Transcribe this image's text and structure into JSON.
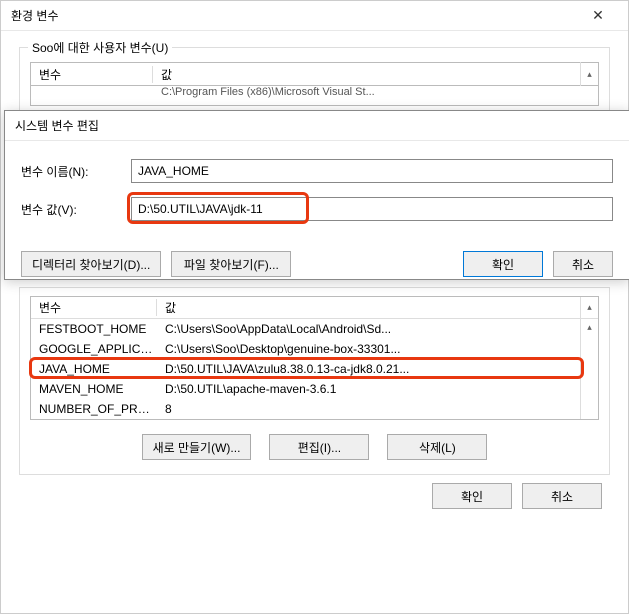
{
  "main_title": "환경 변수",
  "close_glyph": "✕",
  "user_vars": {
    "legend": "Soo에 대한 사용자 변수(U)",
    "col_var": "변수",
    "col_val": "값",
    "cut_row_value": "C:\\Program Files (x86)\\Microsoft Visual St..."
  },
  "edit_dialog": {
    "title": "시스템 변수 편집",
    "name_label": "변수 이름(N):",
    "name_value": "JAVA_HOME",
    "value_label": "변수 값(V):",
    "value_value": "D:\\50.UTIL\\JAVA\\jdk-11",
    "btn_dir": "디렉터리 찾아보기(D)...",
    "btn_file": "파일 찾아보기(F)...",
    "btn_ok": "확인",
    "btn_cancel": "취소"
  },
  "sys_vars": {
    "col_var": "변수",
    "col_val": "값",
    "rows": [
      {
        "name": "FESTBOOT_HOME",
        "value": "C:\\Users\\Soo\\AppData\\Local\\Android\\Sd..."
      },
      {
        "name": "GOOGLE_APPLICA...",
        "value": "C:\\Users\\Soo\\Desktop\\genuine-box-33301..."
      },
      {
        "name": "JAVA_HOME",
        "value": "D:\\50.UTIL\\JAVA\\zulu8.38.0.13-ca-jdk8.0.21..."
      },
      {
        "name": "MAVEN_HOME",
        "value": "D:\\50.UTIL\\apache-maven-3.6.1"
      },
      {
        "name": "NUMBER_OF_PROC...",
        "value": "8"
      }
    ],
    "btn_new": "새로 만들기(W)...",
    "btn_edit": "편집(I)...",
    "btn_delete": "삭제(L)"
  },
  "footer": {
    "ok": "확인",
    "cancel": "취소"
  }
}
